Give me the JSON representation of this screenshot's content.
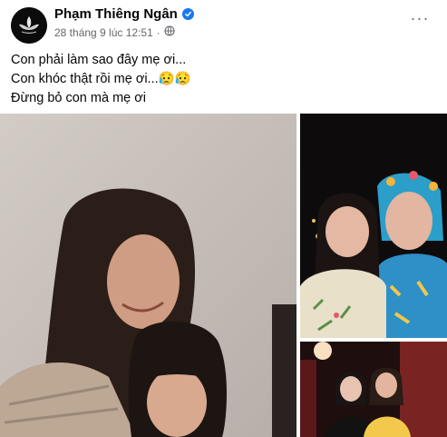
{
  "post": {
    "author": "Phạm Thiêng Ngân",
    "timestamp": "28 tháng 9 lúc 12:51",
    "separator": "·",
    "more_label": "···",
    "lines": [
      "Con phải làm sao đây mẹ ơi...",
      "Con khóc thật rồi mẹ ơi...😥😥",
      "Đừng bỏ con mà mẹ ơi"
    ]
  },
  "icons": {
    "verified": "verified-badge-icon",
    "audience": "globe-icon",
    "more": "more-options-icon",
    "avatar": "lotus-logo"
  },
  "colors": {
    "verified": "#1877f2",
    "meta_text": "#65676b",
    "text": "#050505"
  }
}
